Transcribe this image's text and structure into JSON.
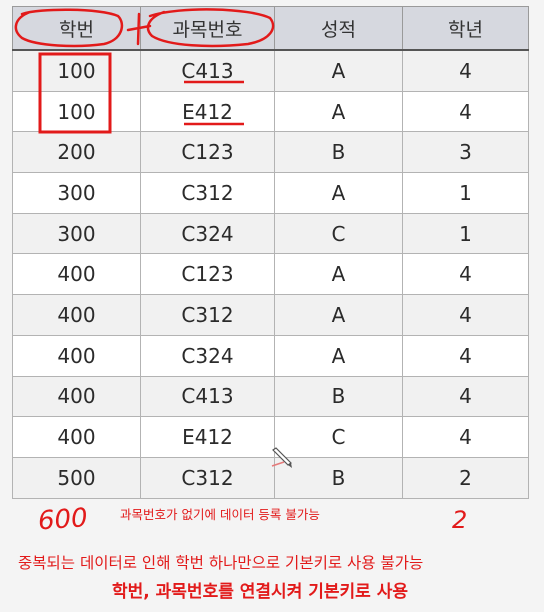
{
  "table": {
    "headers": [
      "학번",
      "과목번호",
      "성적",
      "학년"
    ],
    "rows": [
      [
        "100",
        "C413",
        "A",
        "4"
      ],
      [
        "100",
        "E412",
        "A",
        "4"
      ],
      [
        "200",
        "C123",
        "B",
        "3"
      ],
      [
        "300",
        "C312",
        "A",
        "1"
      ],
      [
        "300",
        "C324",
        "C",
        "1"
      ],
      [
        "400",
        "C123",
        "A",
        "4"
      ],
      [
        "400",
        "C312",
        "A",
        "4"
      ],
      [
        "400",
        "C324",
        "A",
        "4"
      ],
      [
        "400",
        "C413",
        "B",
        "4"
      ],
      [
        "400",
        "E412",
        "C",
        "4"
      ],
      [
        "500",
        "C312",
        "B",
        "2"
      ]
    ]
  },
  "annotations": {
    "handwritten_row_values": [
      "600",
      "2"
    ],
    "note_missing_course": "과목번호가 없기에 데이터 등록 불가능",
    "note_duplicate": "중복되는 데이터로 인해 학번 하나만으로 기본키로 사용 불가능",
    "note_composite_key": "학번, 과목번호를 연결시켜 기본키로 사용"
  },
  "colors": {
    "annotation": "#e21a1a",
    "header_bg": "#d6d8df"
  }
}
